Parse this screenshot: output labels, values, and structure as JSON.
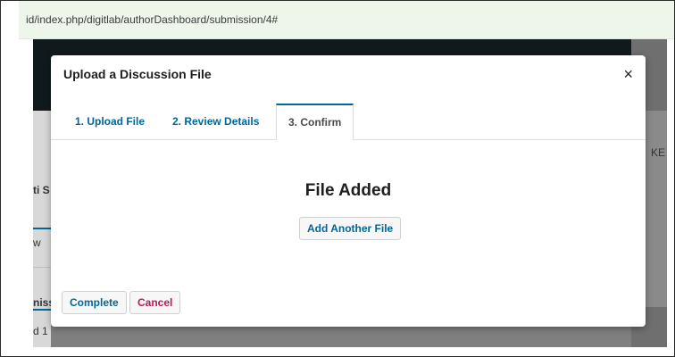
{
  "browser": {
    "url": "id/index.php/digitlab/authorDashboard/submission/4#"
  },
  "background": {
    "fragments": [
      "ti S",
      "w",
      "niss",
      "d 1"
    ],
    "right_fragment": "KE"
  },
  "modal": {
    "title": "Upload a Discussion File",
    "close_glyph": "×",
    "tabs": [
      {
        "label": "1. Upload File"
      },
      {
        "label": "2. Review Details"
      },
      {
        "label": "3. Confirm",
        "active": true
      }
    ],
    "heading": "File Added",
    "add_another_label": "Add Another File",
    "complete_label": "Complete",
    "cancel_label": "Cancel"
  },
  "colors": {
    "accent": "#006798",
    "danger": "#c0165a",
    "overlay": "#7f7f7f"
  }
}
